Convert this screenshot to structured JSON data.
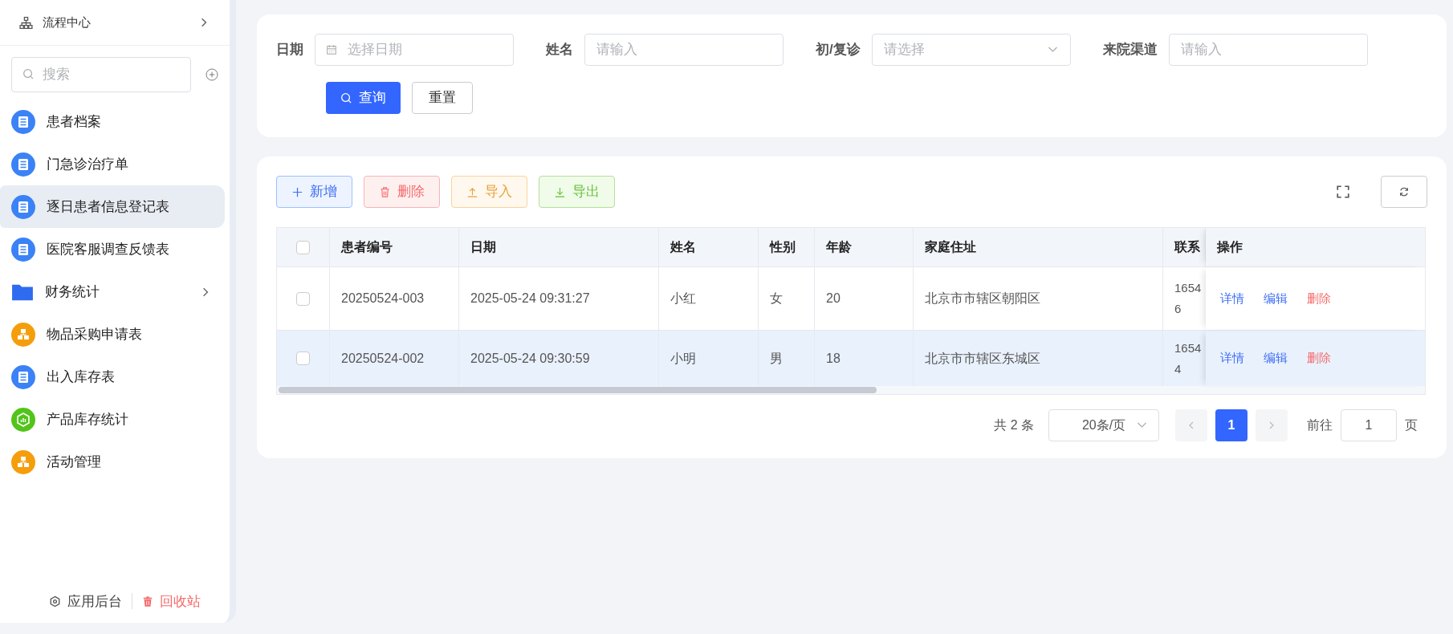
{
  "sidebar": {
    "header": {
      "label": "流程中心"
    },
    "search": {
      "placeholder": "搜索"
    },
    "items": [
      {
        "label": "患者档案",
        "kind": "doc",
        "selected": false
      },
      {
        "label": "门急诊治疗单",
        "kind": "doc",
        "selected": false
      },
      {
        "label": "逐日患者信息登记表",
        "kind": "doc",
        "selected": true
      },
      {
        "label": "医院客服调查反馈表",
        "kind": "doc",
        "selected": false
      },
      {
        "label": "财务统计",
        "kind": "folder",
        "selected": false
      },
      {
        "label": "物品采购申请表",
        "kind": "org",
        "selected": false
      },
      {
        "label": "出入库存表",
        "kind": "doc",
        "selected": false
      },
      {
        "label": "产品库存统计",
        "kind": "chart",
        "selected": false
      },
      {
        "label": "活动管理",
        "kind": "org",
        "selected": false
      }
    ],
    "footer": {
      "admin": "应用后台",
      "trash": "回收站"
    }
  },
  "filters": [
    {
      "label": "日期",
      "kind": "date",
      "placeholder": "选择日期"
    },
    {
      "label": "姓名",
      "kind": "text",
      "placeholder": "请输入"
    },
    {
      "label": "初/复诊",
      "kind": "select",
      "placeholder": "请选择"
    },
    {
      "label": "来院渠道",
      "kind": "text",
      "placeholder": "请输入"
    }
  ],
  "filter_buttons": {
    "query": "查询",
    "reset": "重置"
  },
  "toolbar": [
    {
      "label": "新增",
      "kind": "add"
    },
    {
      "label": "删除",
      "kind": "delete"
    },
    {
      "label": "导入",
      "kind": "import"
    },
    {
      "label": "导出",
      "kind": "export"
    }
  ],
  "table": {
    "select_all": {
      "checked": false
    },
    "columns": [
      "患者编号",
      "日期",
      "姓名",
      "性别",
      "年龄",
      "家庭住址",
      "联系"
    ],
    "action_column": "操作",
    "rows": [
      {
        "selected": false,
        "checked": false,
        "cells": [
          "20250524-003",
          "2025-05-24 09:31:27",
          "小红",
          "女",
          "20",
          "北京市市辖区朝阳区"
        ],
        "contact": [
          "1654",
          "6"
        ],
        "actions": [
          "详情",
          "编辑",
          "删除"
        ]
      },
      {
        "selected": true,
        "checked": false,
        "cells": [
          "20250524-002",
          "2025-05-24 09:30:59",
          "小明",
          "男",
          "18",
          "北京市市辖区东城区"
        ],
        "contact": [
          "1654",
          "4"
        ],
        "actions": [
          "详情",
          "编辑",
          "删除"
        ]
      }
    ]
  },
  "pagination": {
    "total": "共 2 条",
    "page_size": "20条/页",
    "pages": [
      {
        "label": "1",
        "selected": true
      }
    ],
    "goto_label": "前往",
    "goto_value": "1",
    "goto_suffix": "页"
  }
}
